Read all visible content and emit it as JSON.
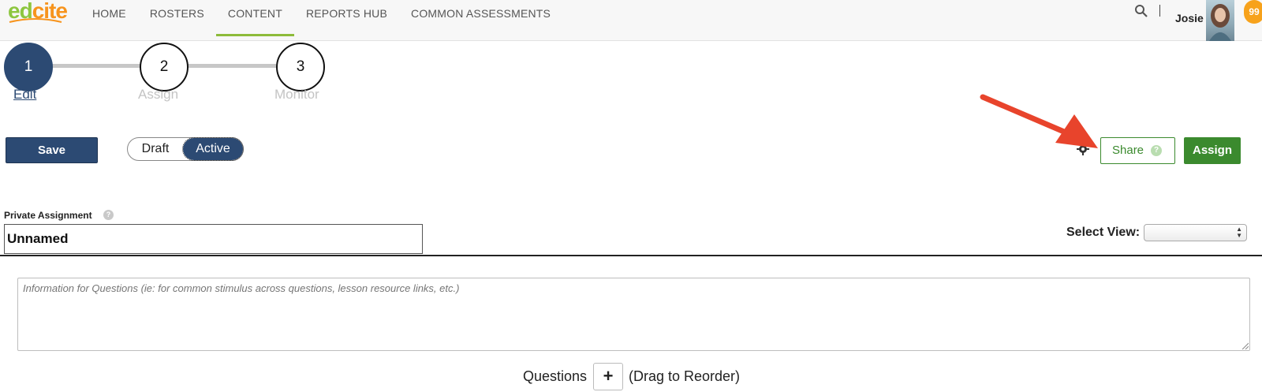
{
  "brand": {
    "logo_part1": "ed",
    "logo_part2": "cite"
  },
  "nav": {
    "items": [
      {
        "label": "HOME"
      },
      {
        "label": "ROSTERS"
      },
      {
        "label": "CONTENT"
      },
      {
        "label": "REPORTS HUB"
      },
      {
        "label": "COMMON ASSESSMENTS"
      }
    ],
    "active": "CONTENT"
  },
  "user": {
    "name": "Josie",
    "notification_count": "99"
  },
  "stepper": {
    "steps": [
      {
        "number": "1",
        "label": "Edit"
      },
      {
        "number": "2",
        "label": "Assign"
      },
      {
        "number": "3",
        "label": "Monitor"
      }
    ],
    "current": "Edit"
  },
  "actions": {
    "save_label": "Save",
    "toggle_draft": "Draft",
    "toggle_active": "Active",
    "share_label": "Share",
    "assign_label": "Assign",
    "help_glyph": "?"
  },
  "assignment": {
    "privacy_label": "Private Assignment",
    "name_value": "Unnamed",
    "select_view_label": "Select View:",
    "select_view_value": ""
  },
  "info": {
    "placeholder": "Information for Questions (ie: for common stimulus across questions, lesson resource links, etc.)"
  },
  "questions": {
    "label": "Questions",
    "add_glyph": "+",
    "hint": "(Drag to Reorder)"
  },
  "colors": {
    "primary_navy": "#2c4a73",
    "green": "#3b8a2e",
    "nav_underline": "#8dbb3a",
    "badge_orange": "#f7a21b",
    "annotation_red": "#e8442c"
  },
  "icons": {
    "search": "search-icon",
    "gear": "gear-icon",
    "help": "help-icon",
    "annotation": "red-arrow"
  }
}
